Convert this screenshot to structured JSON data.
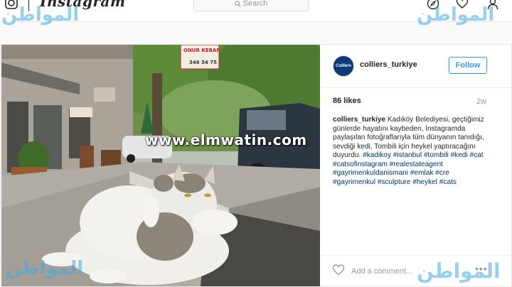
{
  "nav": {
    "wordmark": "Instagram",
    "search_placeholder": "Search"
  },
  "watermarks": {
    "arabic": "المواطن",
    "url": "www.elmwatin.com"
  },
  "photo": {
    "sign_line1": "ONUR KEBAP",
    "sign_line2": "346 34 75"
  },
  "post": {
    "avatar_text": "Colliers",
    "username": "colliers_turkiye",
    "follow_label": "Follow",
    "likes": "86 likes",
    "time": "2w",
    "caption": {
      "username": "colliers_turkiye",
      "text": "Kadıköy Belediyesi, geçtiğimiz günlerde hayatını kaybeden, İnstagramda paylaşılan fotoğraflarıyla tüm dünyanın tanıdığı, sevdiği kedi, Tombili için heykel yaptıracağını duyurdu.",
      "hashtags": "#kadikoy #istanbul #tombili #kedi #cat #catsofinstagram #realestateagent #gayrimenkuldanismani #emlak #cre #gayrimenkul #sculpture #heykel #cats"
    },
    "comment_placeholder": "Add a comment...",
    "more_label": "•••"
  },
  "colors": {
    "accent": "#3897f0",
    "hashtag": "#003569",
    "watermark": "#40aae6",
    "avatar_bg": "#0c3b77"
  }
}
